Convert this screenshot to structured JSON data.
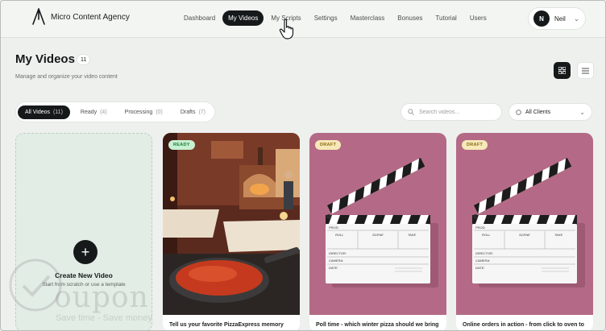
{
  "brand": {
    "name": "Micro Content Agency"
  },
  "nav": {
    "items": [
      {
        "label": "Dashboard",
        "active": false
      },
      {
        "label": "My Videos",
        "active": true
      },
      {
        "label": "My Scripts",
        "active": false
      },
      {
        "label": "Settings",
        "active": false
      },
      {
        "label": "Masterclass",
        "active": false
      },
      {
        "label": "Bonuses",
        "active": false
      },
      {
        "label": "Tutorial",
        "active": false
      },
      {
        "label": "Users",
        "active": false
      }
    ]
  },
  "user": {
    "initial": "N",
    "name": "Neil"
  },
  "header": {
    "title": "My Videos",
    "count": "11",
    "subtitle": "Manage and organize your video content"
  },
  "filters": {
    "tabs": [
      {
        "label": "All Videos",
        "count": "(11)",
        "active": true
      },
      {
        "label": "Ready",
        "count": "(4)",
        "active": false
      },
      {
        "label": "Processing",
        "count": "(0)",
        "active": false
      },
      {
        "label": "Drafts",
        "count": "(7)",
        "active": false
      }
    ],
    "search_placeholder": "Search videos...",
    "client_select": "All Clients"
  },
  "create_card": {
    "title": "Create New Video",
    "subtitle": "Start from scratch or use a template"
  },
  "videos": [
    {
      "status": "READY",
      "title": "Tell us your favorite PizzaExpress memory",
      "thumbnail": "restaurant-pizza-image"
    },
    {
      "status": "DRAFT",
      "title": "Poll time - which winter pizza should we bring",
      "thumbnail": "clapperboard-image"
    },
    {
      "status": "DRAFT",
      "title": "Online orders in action - from click to oven to",
      "thumbnail": "clapperboard-image"
    }
  ],
  "clapperboard": {
    "prod": "PROD.",
    "roll": "ROLL",
    "scene": "SCENE",
    "take": "TAKE",
    "director": "DIRECTOR:",
    "camera": "CAMERA:",
    "date": "DATE:"
  },
  "watermark": {
    "text": "oupon",
    "tagline": "Save time - Save money"
  },
  "colors": {
    "accent": "#15191a",
    "background": "#eef0ee",
    "ready_badge": "#c7f0d2",
    "draft_badge": "#f6e8b8",
    "draft_card_bg": "#b46a86",
    "create_card_bg": "#e2ede5"
  }
}
